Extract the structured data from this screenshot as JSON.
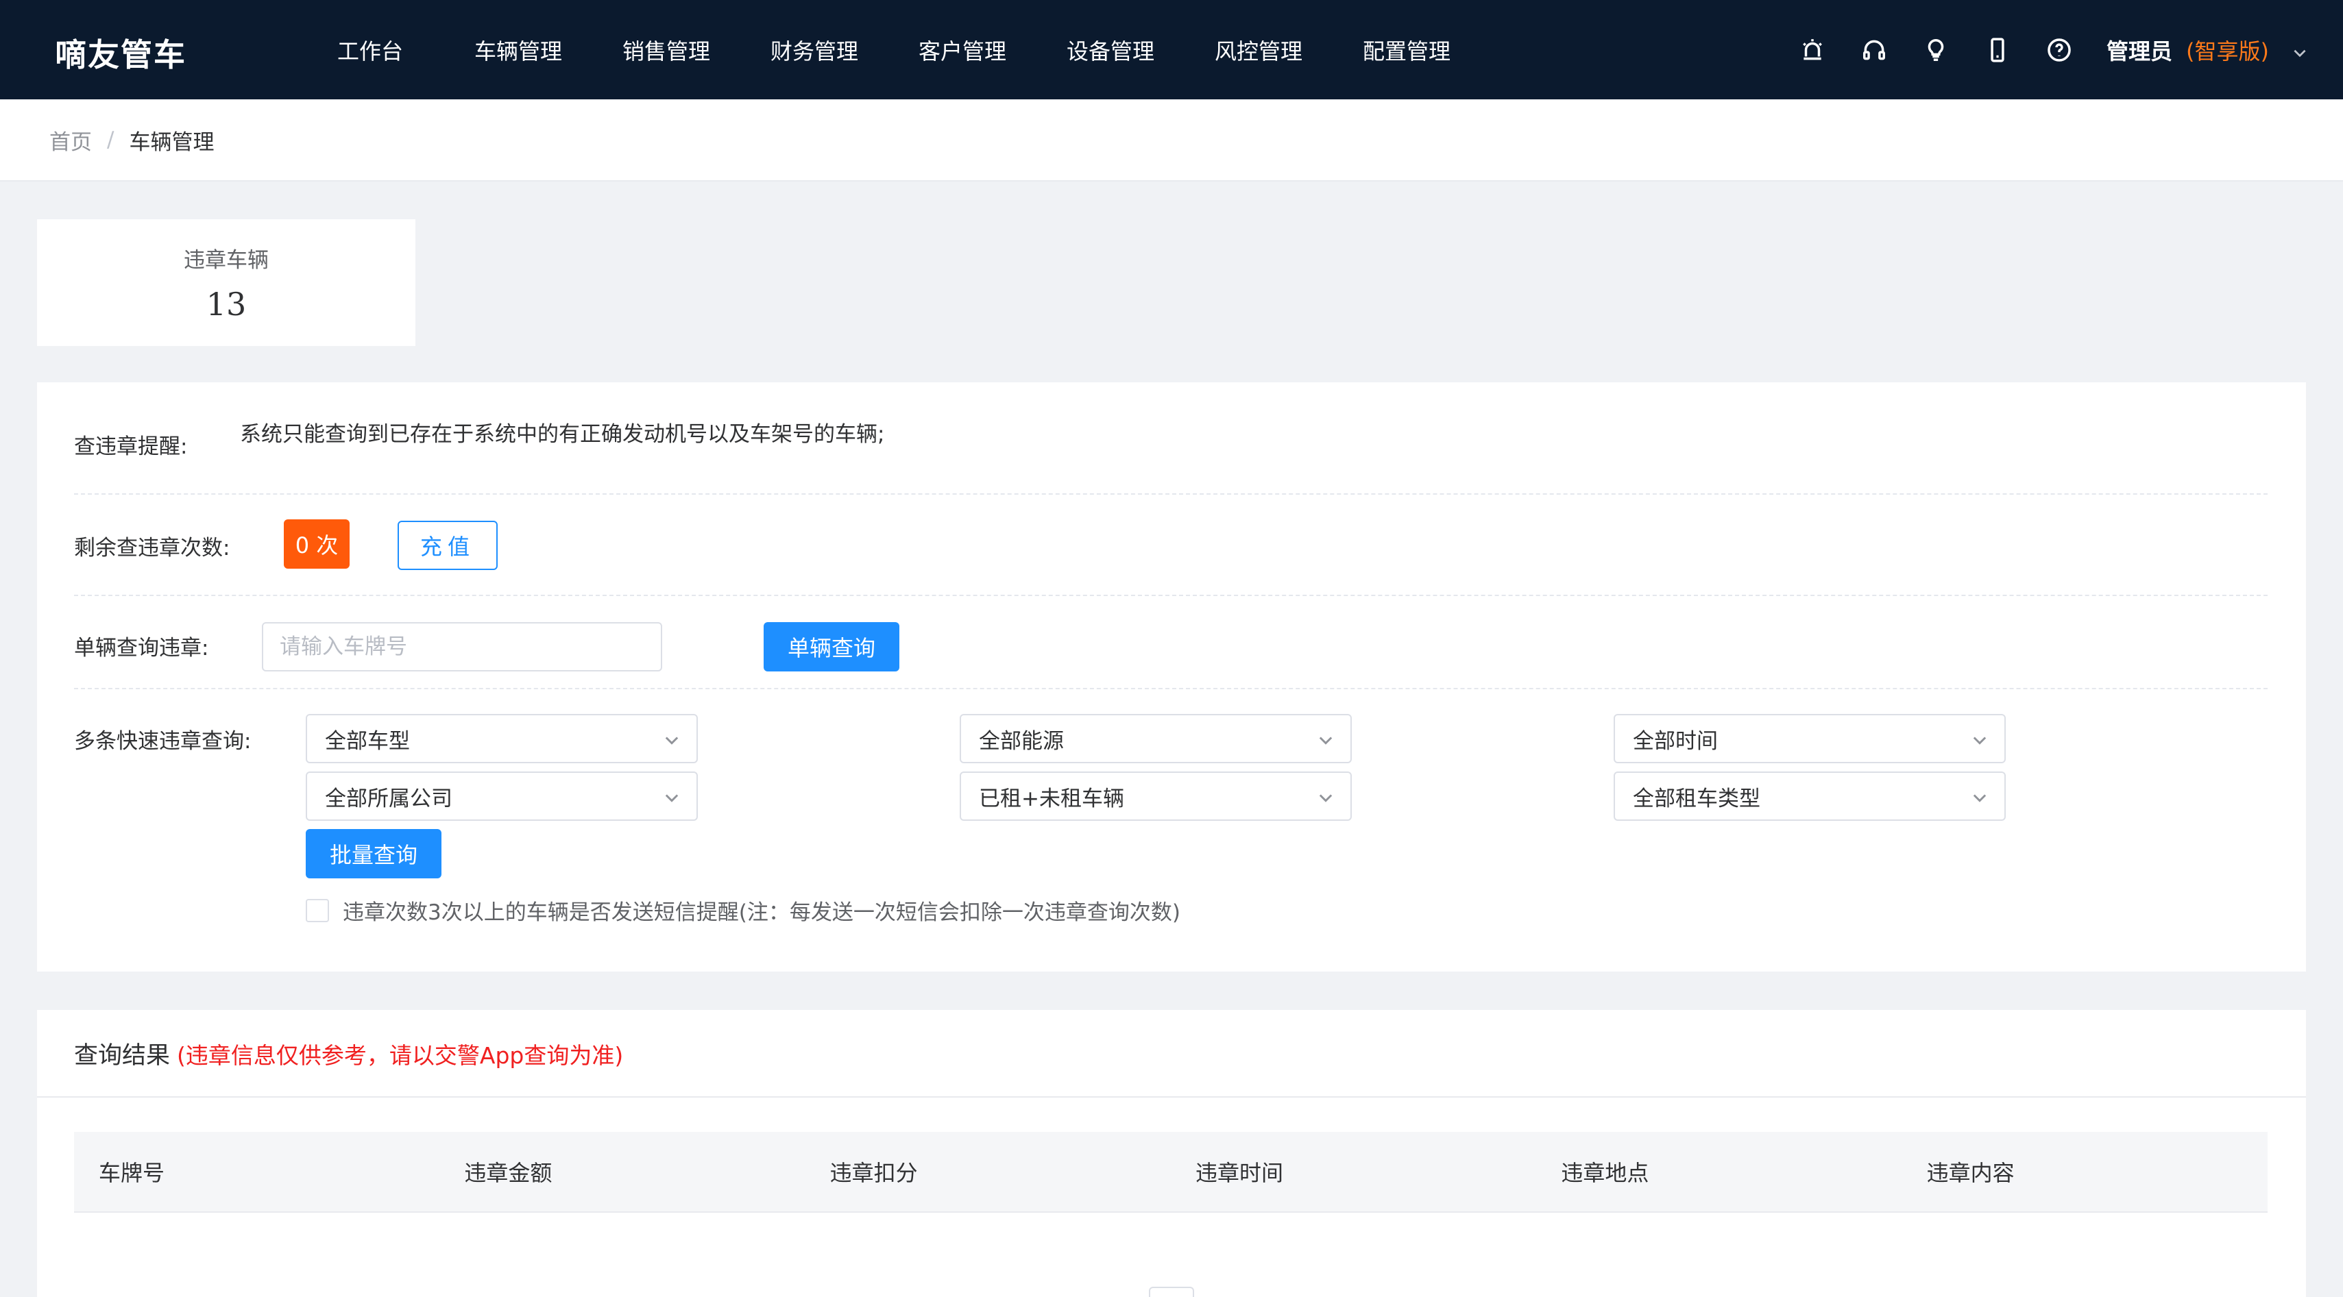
{
  "app": {
    "logo": "嘀友管车"
  },
  "nav": {
    "items": [
      "工作台",
      "车辆管理",
      "销售管理",
      "财务管理",
      "客户管理",
      "设备管理",
      "风控管理",
      "配置管理"
    ]
  },
  "user": {
    "name": "管理员",
    "edition": "(智享版)"
  },
  "toolbar_icons": [
    "alarm-icon",
    "headset-icon",
    "bulb-icon",
    "mobile-icon",
    "help-icon"
  ],
  "breadcrumb": {
    "home": "首页",
    "separator": "/",
    "current": "车辆管理"
  },
  "stat": {
    "label": "违章车辆",
    "value": "13"
  },
  "query": {
    "reminder_label": "查违章提醒:",
    "reminder_text": "系统只能查询到已存在于系统中的有正确发动机号以及车架号的车辆;",
    "remaining_label": "剩余查违章次数:",
    "remaining_count": "0 次",
    "recharge_label": "充值",
    "single_label": "单辆查询违章:",
    "single_placeholder": "请输入车牌号",
    "single_button": "单辆查询",
    "batch_label": "多条快速违章查询:",
    "selects": [
      "全部车型",
      "全部能源",
      "全部时间",
      "全部所属公司",
      "已租+未租车辆",
      "全部租车类型"
    ],
    "batch_button": "批量查询",
    "sms_checkbox_label": "违章次数3次以上的车辆是否发送短信提醒(注：每发送一次短信会扣除一次违章查询次数)",
    "sms_checked": false
  },
  "results": {
    "title": "查询结果",
    "note": "(违章信息仅供参考，请以交警App查询为准)",
    "columns": [
      "车牌号",
      "违章金额",
      "违章扣分",
      "违章时间",
      "违章地点",
      "违章内容"
    ]
  },
  "colors": {
    "topbar": "#0b1a2e",
    "primary": "#1e8fff",
    "badge": "#ff5a0a",
    "edition": "#ff7a1a",
    "warning_text": "#f02020"
  }
}
